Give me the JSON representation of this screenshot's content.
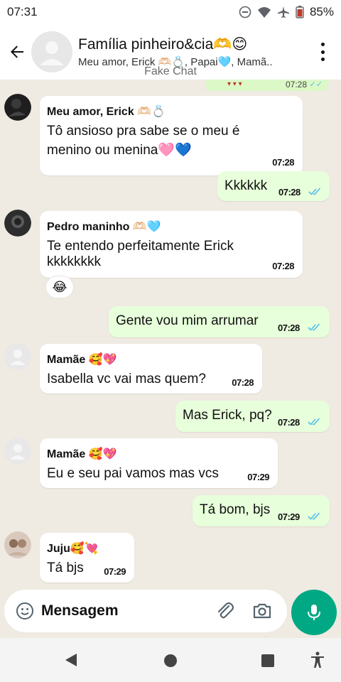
{
  "status_bar": {
    "time": "07:31",
    "battery": "85%"
  },
  "header": {
    "title": "Família pinheiro&cia🫶😊",
    "members": "Meu amor, Erick 🫶🏻💍, Papai🩵, Mamã..",
    "watermark": "Fake Chat"
  },
  "previous_message": {
    "time": "07:28"
  },
  "messages": [
    {
      "direction": "in",
      "sender": "Meu amor, Erick 🫶🏻💍",
      "lines": [
        "Tô ansioso pra sabe se o meu é",
        "menino ou menina🩷💙"
      ],
      "time": "07:28"
    },
    {
      "direction": "out",
      "lines": [
        "Kkkkkk"
      ],
      "time": "07:28"
    },
    {
      "direction": "in",
      "sender": "Pedro maninho 🫶🏻🩵",
      "lines": [
        "Te entendo perfeitamente Erick",
        "kkkkkkkk"
      ],
      "time": "07:28",
      "reaction": "😂"
    },
    {
      "direction": "out",
      "lines": [
        "Gente vou mim arrumar"
      ],
      "time": "07:28"
    },
    {
      "direction": "in",
      "sender": "Mamãe 🥰💖",
      "lines": [
        "Isabella vc vai mas quem?"
      ],
      "time": "07:28"
    },
    {
      "direction": "out",
      "lines": [
        "Mas Erick, pq?"
      ],
      "time": "07:28"
    },
    {
      "direction": "in",
      "sender": "Mamãe 🥰💖",
      "lines": [
        "Eu e seu pai vamos mas vcs"
      ],
      "time": "07:29"
    },
    {
      "direction": "out",
      "lines": [
        "Tá bom, bjs"
      ],
      "time": "07:29"
    },
    {
      "direction": "in",
      "sender": "Juju🥰💘",
      "lines": [
        "Tá bjs"
      ],
      "time": "07:29"
    }
  ],
  "composer": {
    "placeholder": "Mensagem"
  },
  "icons": {
    "back": "arrow-left-icon",
    "menu": "three-dots-icon",
    "emoji": "emoji-icon",
    "attach": "paperclip-icon",
    "camera": "camera-icon",
    "mic": "microphone-icon",
    "read": "double-check-icon"
  },
  "colors": {
    "accent": "#00a884",
    "outgoing_bubble": "#e7ffdb",
    "incoming_bubble": "#ffffff",
    "chat_background": "#efeae2",
    "read_tick": "#53bdeb"
  }
}
